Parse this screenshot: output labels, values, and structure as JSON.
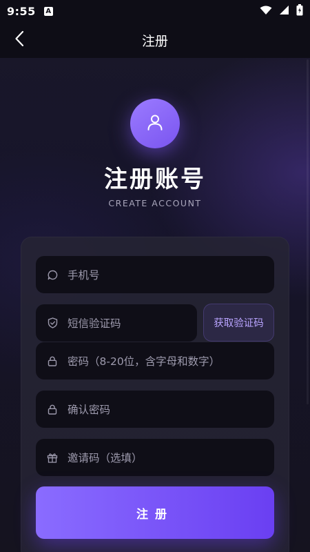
{
  "status_bar": {
    "time": "9:55",
    "a_badge": "A",
    "icons": [
      "wifi-icon",
      "signal-icon",
      "battery-icon"
    ]
  },
  "nav": {
    "title": "注册",
    "back_icon": "chevron-left-icon"
  },
  "header": {
    "avatar_icon": "user-icon",
    "title": "注册账号",
    "subtitle": "CREATE ACCOUNT"
  },
  "form": {
    "phone": {
      "placeholder": "手机号",
      "icon": "chat-bubble-icon"
    },
    "sms_code": {
      "placeholder": "短信验证码",
      "icon": "shield-icon"
    },
    "get_code_label": "获取验证码",
    "password": {
      "placeholder": "密码（8-20位，含字母和数字）",
      "icon": "lock-icon"
    },
    "confirm_password": {
      "placeholder": "确认密码",
      "icon": "lock-icon"
    },
    "invite_code": {
      "placeholder": "邀请码（选填）",
      "icon": "gift-icon"
    },
    "submit_label": "注册"
  },
  "colors": {
    "accent": "#7a55f0",
    "accent_light": "#9b7bff",
    "background": "#14121f",
    "field_bg": "#0f0e17",
    "card_bg": "#262434"
  }
}
